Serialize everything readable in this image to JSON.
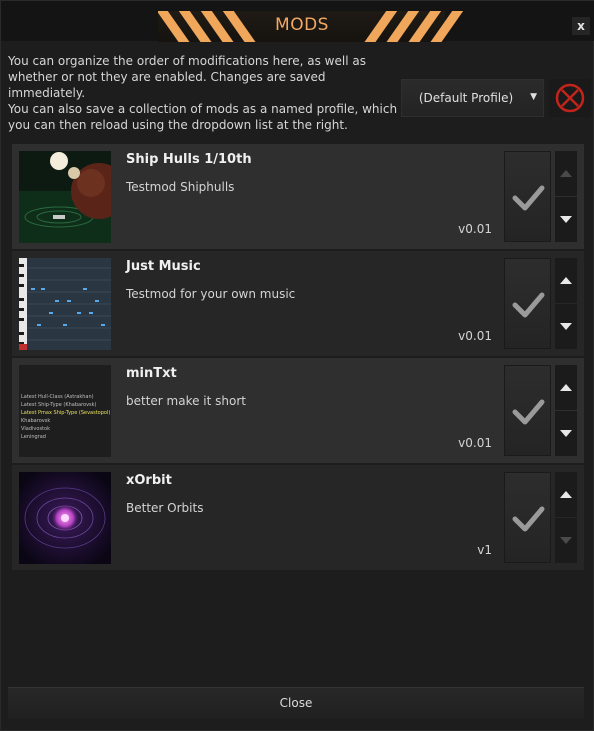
{
  "window": {
    "title": "MODS",
    "close_label": "x"
  },
  "description": {
    "line1": "You can organize the order of modifications here, as well as whether or not they are enabled. Changes are saved immediately.",
    "line2": "You can also save a collection of mods as a named profile, which you can then reload using the dropdown list at the right."
  },
  "profile": {
    "selected": "(Default Profile)",
    "delete_icon": "delete-circle-x-icon",
    "delete_color": "#c2241c"
  },
  "mods": [
    {
      "name": "Ship Hulls 1/10th",
      "description": "Testmod Shiphulls",
      "version": "v0.01",
      "enabled": true,
      "up_enabled": false,
      "down_enabled": true
    },
    {
      "name": "Just Music",
      "description": "Testmod for your own music",
      "version": "v0.01",
      "enabled": true,
      "up_enabled": true,
      "down_enabled": true
    },
    {
      "name": "minTxt",
      "description": "better make it short",
      "version": "v0.01",
      "enabled": true,
      "up_enabled": true,
      "down_enabled": true
    },
    {
      "name": "xOrbit",
      "description": "Better Orbits",
      "version": "v1",
      "enabled": true,
      "up_enabled": true,
      "down_enabled": false
    }
  ],
  "thumbnail_text": {
    "mintxt_lines": [
      "Latest Hull-Class (Astrakhan)",
      "Latest Ship-Type (Khabarovsk)",
      "Latest Pmax Ship-Type (Sevastopol)",
      "Khabarovsk",
      "Vladivostok",
      "Leningrad"
    ]
  },
  "footer": {
    "close_label": "Close"
  },
  "colors": {
    "accent": "#f0a75b",
    "background": "#1d1d1d",
    "row_light": "#2f2f2f",
    "row_dark": "#262626"
  }
}
